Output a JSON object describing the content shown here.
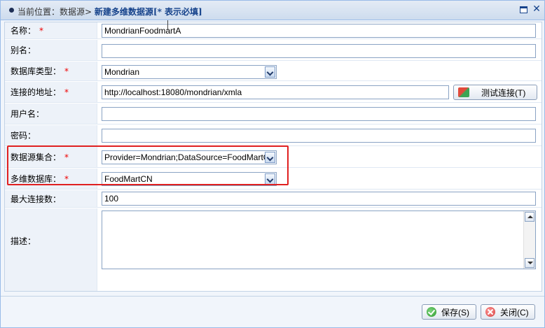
{
  "header": {
    "location_prefix": "当前位置：",
    "crumb_datasource": "数据源",
    "separator": ">",
    "title": "新建多维数据源[* 表示必填]"
  },
  "form": {
    "fields": [
      {
        "label": "名称：",
        "required": true,
        "value": "MondrianFoodmartA"
      },
      {
        "label": "别名：",
        "required": false,
        "value": ""
      },
      {
        "label": "数据库类型：",
        "required": true,
        "value": "Mondrian"
      },
      {
        "label": "连接的地址：",
        "required": true,
        "value": "http://localhost:18080/mondrian/xmla"
      },
      {
        "label": "用户名：",
        "required": false,
        "value": ""
      },
      {
        "label": "密码：",
        "required": false,
        "value": ""
      },
      {
        "label": "数据源集合：",
        "required": true,
        "value": "Provider=Mondrian;DataSource=FoodMartC"
      },
      {
        "label": "多维数据库：",
        "required": true,
        "value": "FoodMartCN"
      },
      {
        "label": "最大连接数：",
        "required": false,
        "value": "100"
      },
      {
        "label": "描述：",
        "required": false,
        "value": ""
      }
    ],
    "required_mark": "*",
    "test_button_label": "测试连接(T)"
  },
  "footer": {
    "save_label": "保存(S)",
    "close_label": "关闭(C)"
  },
  "colors": {
    "accent": "#15428b",
    "required": "#e00000",
    "highlight": "#e02020"
  }
}
